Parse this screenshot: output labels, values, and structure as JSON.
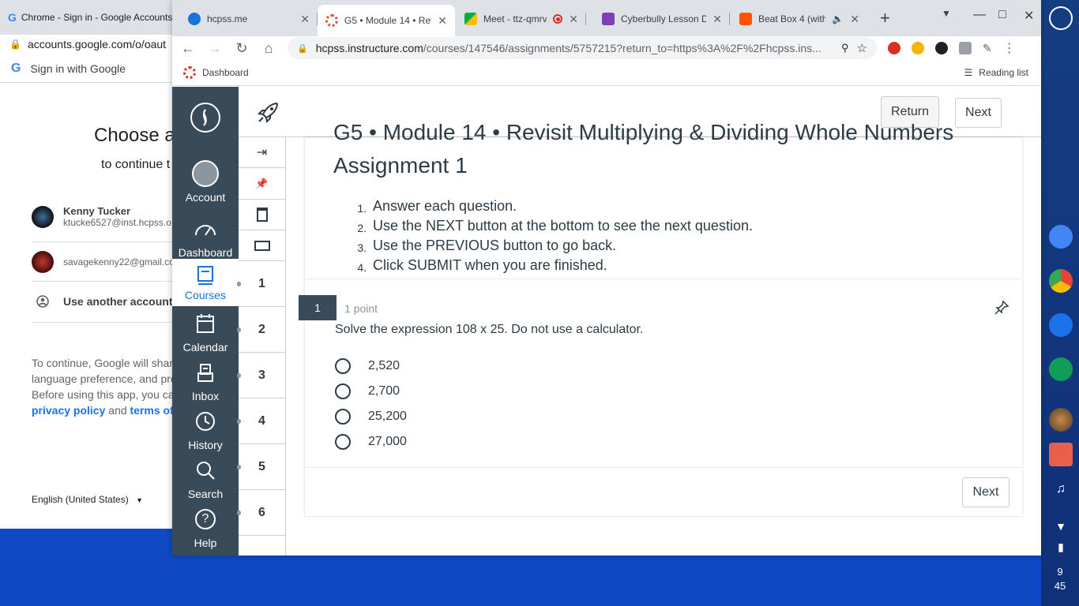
{
  "bg_window": {
    "tab_title": "Chrome - Sign in - Google Accounts",
    "url": "accounts.google.com/o/oaut",
    "signin_bar": "Sign in with Google",
    "heading": "Choose a",
    "subheading": "to continue t",
    "accounts": [
      {
        "name": "Kenny Tucker",
        "email": "ktucke6527@inst.hcpss.o"
      },
      {
        "name": "",
        "email": "savagekenny22@gmail.co"
      }
    ],
    "use_another": "Use another account",
    "notice_line1": "To continue, Google will shar",
    "notice_line2": "language preference, and pro",
    "notice_line3": "Before using this app, you ca",
    "privacy_link": "privacy policy",
    "and_text": "and",
    "terms_link": "terms of",
    "language": "English (United States)"
  },
  "browser": {
    "tabs": [
      {
        "title": "hcpss.me",
        "color": "#1a73d8",
        "active": false
      },
      {
        "title": "G5 • Module 14 • Rev",
        "color": "#e0504a",
        "active": true
      },
      {
        "title": "Meet - ttz-qmrv-g",
        "color": "#00ac47",
        "active": false
      },
      {
        "title": "Cyberbully Lesson D",
        "color": "#7b3fb6",
        "active": false
      },
      {
        "title": "Beat Box 4 (with",
        "color": "#ff5500",
        "active": false
      }
    ],
    "url_host": "hcpss.instructure.com",
    "url_path": "/courses/147546/assignments/5757215?return_to=https%3A%2F%2Fhcpss.ins...",
    "bookmark": "Dashboard",
    "reading_list": "Reading list"
  },
  "canvas": {
    "nav": [
      {
        "label": "Account",
        "icon": "account-icon"
      },
      {
        "label": "Dashboard",
        "icon": "dashboard-icon"
      },
      {
        "label": "Courses",
        "icon": "courses-icon"
      },
      {
        "label": "Calendar",
        "icon": "calendar-icon"
      },
      {
        "label": "Inbox",
        "icon": "inbox-icon"
      },
      {
        "label": "History",
        "icon": "history-icon"
      },
      {
        "label": "Search",
        "icon": "search-icon"
      },
      {
        "label": "Help",
        "icon": "help-icon"
      }
    ],
    "question_numbers": [
      "1",
      "2",
      "3",
      "4",
      "5",
      "6"
    ],
    "return_label": "Return",
    "next_label": "Next",
    "title_line1": "G5 • Module 14 • Revisit Multiplying & Dividing Whole Numbers",
    "title_line2": "Assignment 1",
    "instructions": [
      "Answer each question.",
      "Use the NEXT button at the bottom to see the next question.",
      "Use the PREVIOUS button to go back.",
      "Click SUBMIT when you are finished."
    ],
    "instruction_numbers": [
      "1.",
      "2.",
      "3.",
      "4."
    ],
    "question": {
      "number": "1",
      "points": "1 point",
      "text": "Solve the expression 108 x 25.  Do not use a calculator.",
      "options": [
        "2,520",
        "2,700",
        "25,200",
        "27,000"
      ]
    },
    "bottom_next": "Next",
    "accent": "#394b58"
  },
  "shelf": {
    "clock_hour": "9",
    "clock_min": "45"
  }
}
